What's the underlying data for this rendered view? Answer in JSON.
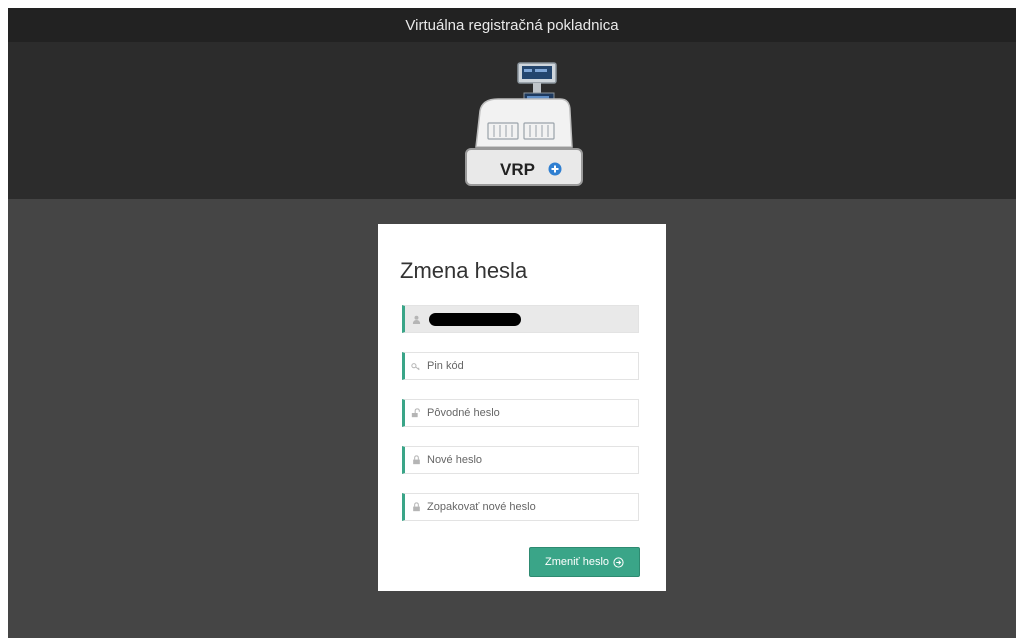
{
  "header": {
    "app_title": "Virtuálna registračná pokladnica",
    "logo_text": "VRP"
  },
  "form": {
    "title": "Zmena hesla",
    "fields": [
      {
        "icon": "user-icon",
        "value": "[redacted]",
        "placeholder": "",
        "readonly": true
      },
      {
        "icon": "key-icon",
        "value": "",
        "placeholder": "Pin kód"
      },
      {
        "icon": "unlock-icon",
        "value": "",
        "placeholder": "Pôvodné heslo"
      },
      {
        "icon": "lock-icon",
        "value": "",
        "placeholder": "Nové heslo"
      },
      {
        "icon": "lock-icon",
        "value": "",
        "placeholder": "Zopakovať nové heslo"
      }
    ],
    "submit_label": "Zmeniť heslo",
    "submit_icon": "arrow-right-circle-icon"
  },
  "colors": {
    "accent": "#3aa588",
    "titlebar_bg": "#222222",
    "header_bg": "#2c2c2c",
    "page_bg": "#454545"
  }
}
